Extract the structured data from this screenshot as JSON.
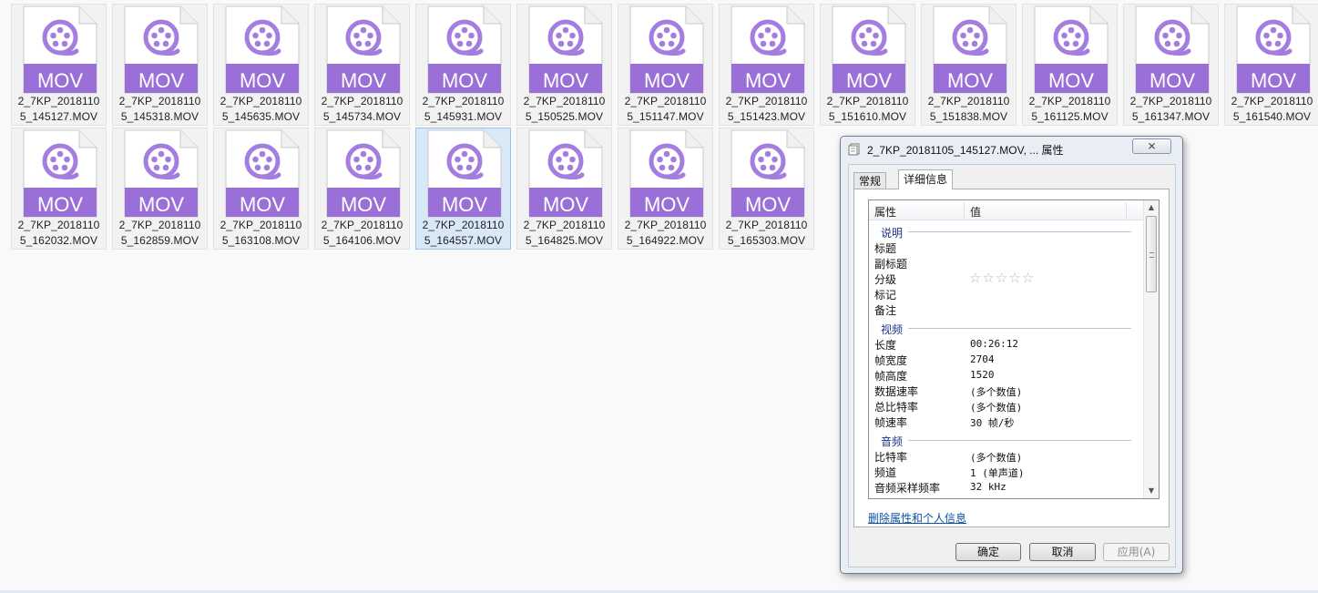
{
  "files": {
    "icon_label": "MOV",
    "selected_index": 17,
    "rows": [
      [
        {
          "line1": "2_7KP_2018110",
          "line2": "5_145127.MOV"
        },
        {
          "line1": "2_7KP_2018110",
          "line2": "5_145318.MOV"
        },
        {
          "line1": "2_7KP_2018110",
          "line2": "5_145635.MOV"
        },
        {
          "line1": "2_7KP_2018110",
          "line2": "5_145734.MOV"
        },
        {
          "line1": "2_7KP_2018110",
          "line2": "5_145931.MOV"
        },
        {
          "line1": "2_7KP_2018110",
          "line2": "5_150525.MOV"
        },
        {
          "line1": "2_7KP_2018110",
          "line2": "5_151147.MOV"
        },
        {
          "line1": "2_7KP_2018110",
          "line2": "5_151423.MOV"
        },
        {
          "line1": "2_7KP_2018110",
          "line2": "5_151610.MOV"
        },
        {
          "line1": "2_7KP_2018110",
          "line2": "5_151838.MOV"
        },
        {
          "line1": "2_7KP_2018110",
          "line2": "5_161125.MOV"
        },
        {
          "line1": "2_7KP_2018110",
          "line2": "5_161347.MOV"
        },
        {
          "line1": "2_7KP_2018110",
          "line2": "5_161540.MOV"
        }
      ],
      [
        {
          "line1": "2_7KP_2018110",
          "line2": "5_162032.MOV"
        },
        {
          "line1": "2_7KP_2018110",
          "line2": "5_162859.MOV"
        },
        {
          "line1": "2_7KP_2018110",
          "line2": "5_163108.MOV"
        },
        {
          "line1": "2_7KP_2018110",
          "line2": "5_164106.MOV"
        },
        {
          "line1": "2_7KP_2018110",
          "line2": "5_164557.MOV"
        },
        {
          "line1": "2_7KP_2018110",
          "line2": "5_164825.MOV"
        },
        {
          "line1": "2_7KP_2018110",
          "line2": "5_164922.MOV"
        },
        {
          "line1": "2_7KP_2018110",
          "line2": "5_165303.MOV"
        }
      ]
    ]
  },
  "dialog": {
    "title": "2_7KP_20181105_145127.MOV, ... 属性",
    "close_label": "⨯",
    "tabs": {
      "general": "常规",
      "details": "详细信息"
    },
    "columns": {
      "name": "属性",
      "value": "值"
    },
    "groups": {
      "description": {
        "label": "说明",
        "items": [
          {
            "key": "标题",
            "value": ""
          },
          {
            "key": "副标题",
            "value": ""
          },
          {
            "key": "分级",
            "value": "☆☆☆☆☆"
          },
          {
            "key": "标记",
            "value": ""
          },
          {
            "key": "备注",
            "value": ""
          }
        ]
      },
      "video": {
        "label": "视频",
        "items": [
          {
            "key": "长度",
            "value": "00:26:12"
          },
          {
            "key": "帧宽度",
            "value": "2704"
          },
          {
            "key": "帧高度",
            "value": "1520"
          },
          {
            "key": "数据速率",
            "value": "(多个数值)"
          },
          {
            "key": "总比特率",
            "value": "(多个数值)"
          },
          {
            "key": "帧速率",
            "value": "30 帧/秒"
          }
        ]
      },
      "audio": {
        "label": "音频",
        "items": [
          {
            "key": "比特率",
            "value": "(多个数值)"
          },
          {
            "key": "频道",
            "value": "1 (单声道)"
          },
          {
            "key": "音频采样频率",
            "value": "32 kHz"
          }
        ]
      }
    },
    "remove_link": "删除属性和个人信息",
    "buttons": {
      "ok": "确定",
      "cancel": "取消",
      "apply": "应用(A)"
    }
  },
  "colors": {
    "mov_purple": "#a47de0",
    "mov_band": "#9a6fd8",
    "selection": "#d9e8f7"
  },
  "icons": {
    "file_icon": "mov-file-icon",
    "title_icon": "properties-icon"
  }
}
